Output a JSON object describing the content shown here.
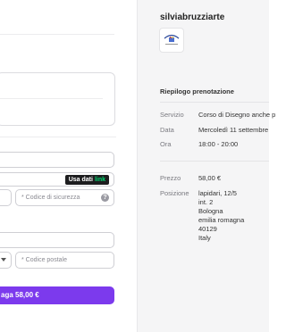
{
  "payment": {
    "link_badge_text": "Usa dati",
    "link_brand": "link",
    "cvc_placeholder": "* Codice di sicurezza",
    "cvc_help_glyph": "?",
    "postal_placeholder": "* Codice postale",
    "pay_button_label": "aga 58,00 €",
    "accent_color": "#7c3aed"
  },
  "summary": {
    "shop_name": "silviabruzziarte",
    "title": "Riepilogo prenotazione",
    "rows": [
      {
        "label": "Servizio",
        "value": "Corso di Disegno anche p"
      },
      {
        "label": "Data",
        "value": "Mercoledì 11 settembre"
      },
      {
        "label": "Ora",
        "value": "18:00 - 20:00"
      }
    ],
    "price_label": "Prezzo",
    "price_value": "58,00 €",
    "location_label": "Posizione",
    "address_lines": [
      "lapidari, 12/5",
      "int. 2",
      "Bologna",
      "emilia romagna",
      "40129",
      "Italy"
    ]
  }
}
